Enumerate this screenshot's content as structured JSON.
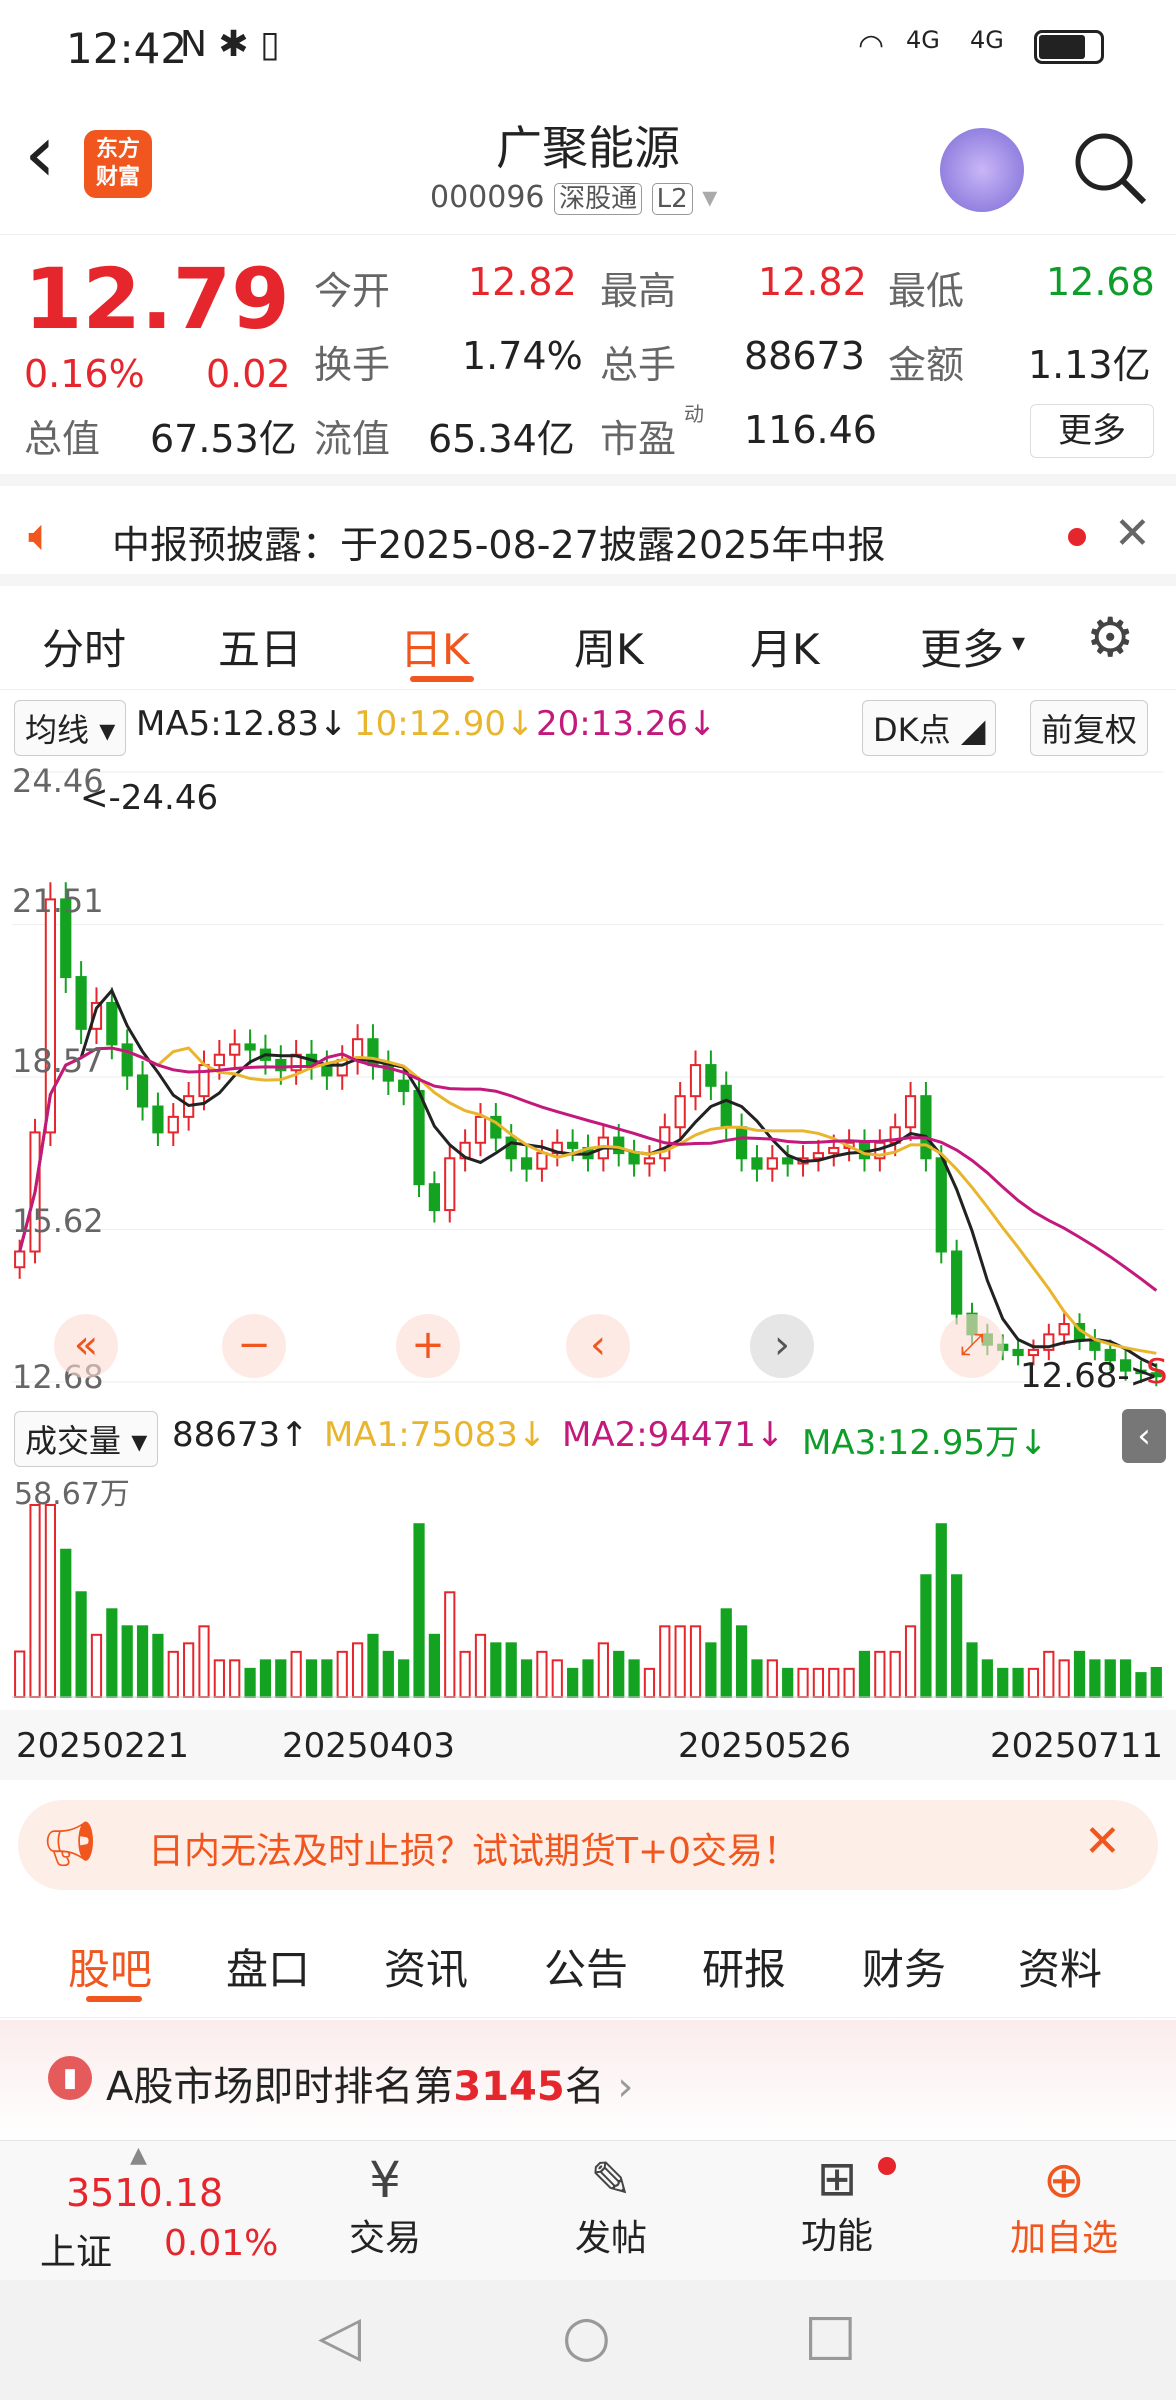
{
  "status": {
    "time": "12:42",
    "icons": "N ✱ ▯",
    "signal1": "4G",
    "signal2": "4G"
  },
  "header": {
    "back": "‹",
    "logo_top": "东方",
    "logo_bottom": "财富",
    "name": "广聚能源",
    "code": "000096",
    "badge1": "深股通",
    "badge2": "L2"
  },
  "quote": {
    "price": "12.79",
    "pct": "0.16%",
    "chg": "0.02",
    "open_label": "今开",
    "open": "12.82",
    "high_label": "最高",
    "high": "12.82",
    "low_label": "最低",
    "low": "12.68",
    "turn_label": "换手",
    "turn": "1.74%",
    "vol_label": "总手",
    "vol": "88673",
    "amt_label": "金额",
    "amt": "1.13亿",
    "mcap_label": "总值",
    "mcap": "67.53亿",
    "float_label": "流值",
    "float": "65.34亿",
    "pe_label": "市盈",
    "pe_sup": "动",
    "pe": "116.46",
    "more": "更多"
  },
  "notice": {
    "text": "中报预披露：于2025-08-27披露2025年中报"
  },
  "tabs": [
    "分时",
    "五日",
    "日K",
    "周K",
    "月K",
    "更多"
  ],
  "ma": {
    "sel": "均线",
    "ma5": "MA5:12.83↓",
    "ma10": "10:12.90↓",
    "ma20": "20:13.26↓",
    "dk": "DK点",
    "fq": "前复权"
  },
  "chart": {
    "ticks": [
      "24.46",
      "21.51",
      "18.57",
      "15.62",
      "12.68"
    ],
    "max_label": "<-24.46",
    "min_label": "12.68->",
    "s_mark": "S"
  },
  "volume": {
    "sel": "成交量",
    "val": "88673↑",
    "ma1": "MA1:75083↓",
    "ma2": "MA2:94471↓",
    "ma3": "MA3:12.95万↓",
    "max": "58.67万"
  },
  "dates": [
    "20250221",
    "20250403",
    "20250526",
    "20250711"
  ],
  "ad": {
    "text": "日内无法及时止损？试试期货T+0交易！"
  },
  "guba_tabs": [
    "股吧",
    "盘口",
    "资讯",
    "公告",
    "研报",
    "财务",
    "资料"
  ],
  "rank": {
    "prefix": "A股市场即时排名第",
    "num": "3145",
    "suffix": "名"
  },
  "bottom": {
    "index_val": "3510.18",
    "index_name": "上证",
    "index_pct": "0.01%",
    "trade": "交易",
    "post": "发帖",
    "func": "功能",
    "add": "加自选"
  },
  "chart_data": {
    "type": "candlestick",
    "title": "广聚能源 日K",
    "ylim": [
      12.68,
      24.46
    ],
    "close": [
      15.2,
      17.5,
      22.0,
      20.5,
      19.5,
      20.0,
      19.2,
      18.6,
      18.0,
      17.5,
      17.8,
      18.2,
      18.8,
      19.0,
      19.2,
      19.1,
      18.9,
      18.7,
      19.0,
      18.8,
      18.6,
      18.9,
      19.3,
      18.8,
      18.5,
      18.3,
      16.5,
      16.0,
      17.0,
      17.3,
      17.8,
      17.4,
      17.0,
      16.8,
      17.1,
      17.3,
      17.2,
      17.0,
      17.4,
      17.1,
      16.9,
      17.0,
      17.6,
      18.2,
      18.8,
      18.4,
      17.6,
      17.0,
      16.8,
      17.0,
      16.9,
      17.0,
      17.1,
      17.2,
      17.3,
      17.0,
      17.3,
      17.6,
      18.2,
      17.0,
      15.2,
      14.0,
      13.6,
      13.4,
      13.3,
      13.2,
      13.3,
      13.6,
      13.8,
      13.5,
      13.3,
      13.1,
      12.9,
      12.85,
      12.79
    ],
    "ma5": 12.83,
    "ma10": 12.9,
    "ma20": 13.26,
    "volume_max": 586700,
    "volume_last": 88673
  }
}
